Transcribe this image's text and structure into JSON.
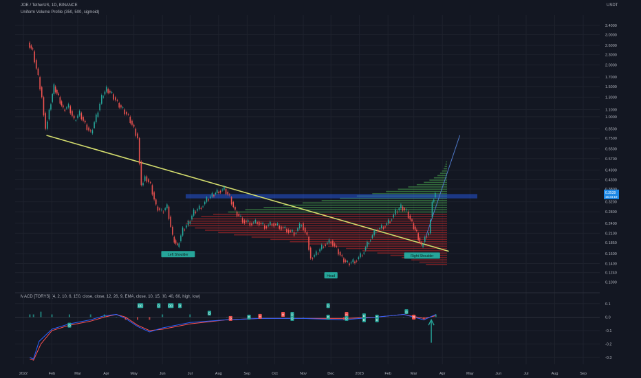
{
  "header": {
    "symbol_line": "JOE / TetherUS, 1D, BINANCE",
    "indicator_line": "Uniform Volume Profile (350, 500, sigmoid)",
    "macd_line": "MACD [TORYS] (4, 2, 10, 6, 150, close, close, 12, 26, 9, EMA, close, 10, 15, 30, 40, 60, high, low)",
    "currency": "USDT"
  },
  "chart_data": [
    {
      "type": "line",
      "subtype": "candlestick_with_volume_profile",
      "title": "JOE / TetherUS, 1D, BINANCE",
      "ylabel": "USDT",
      "yscale": "log",
      "ylim": [
        0.1,
        3.9
      ],
      "y_ticks": [
        "3.4000",
        "3.0000",
        "2.6000",
        "2.3000",
        "2.0000",
        "1.7000",
        "1.5000",
        "1.3000",
        "1.1000",
        "1.0000",
        "0.8500",
        "0.7500",
        "0.6500",
        "0.5700",
        "0.4900",
        "0.4300",
        "0.3800",
        "0.3200",
        "0.2800",
        "0.2400",
        "0.2100",
        "0.1850",
        "0.1600",
        "0.1400",
        "0.1240",
        "0.1090"
      ],
      "y_tick_values": [
        3.4,
        3.0,
        2.6,
        2.3,
        2.0,
        1.7,
        1.5,
        1.3,
        1.1,
        1.0,
        0.85,
        0.75,
        0.65,
        0.57,
        0.49,
        0.43,
        0.38,
        0.32,
        0.28,
        0.24,
        0.21,
        0.185,
        0.16,
        0.14,
        0.124,
        0.109
      ],
      "x_ticks": [
        "2022",
        "Feb",
        "Mar",
        "Apr",
        "May",
        "Jun",
        "Jul",
        "Aug",
        "Sep",
        "Oct",
        "Nov",
        "Dec",
        "2023",
        "Feb",
        "Mar",
        "Apr",
        "May",
        "Jun",
        "Jul",
        "Aug",
        "Sep"
      ],
      "x_tick_months": [
        0,
        1,
        2,
        3,
        4,
        5,
        6,
        7,
        8,
        9,
        10,
        11,
        12,
        13,
        14,
        15,
        16,
        17,
        18,
        19,
        20
      ],
      "x_start": "2022-01-01",
      "price_series": [
        [
          "2022-01-07",
          2.7
        ],
        [
          "2022-01-12",
          2.4
        ],
        [
          "2022-01-18",
          1.7
        ],
        [
          "2022-01-22",
          1.3
        ],
        [
          "2022-01-26",
          0.85
        ],
        [
          "2022-01-30",
          1.1
        ],
        [
          "2022-02-04",
          1.5
        ],
        [
          "2022-02-09",
          1.3
        ],
        [
          "2022-02-14",
          1.1
        ],
        [
          "2022-02-20",
          1.15
        ],
        [
          "2022-02-26",
          0.95
        ],
        [
          "2022-03-04",
          1.05
        ],
        [
          "2022-03-10",
          0.9
        ],
        [
          "2022-03-16",
          0.8
        ],
        [
          "2022-03-22",
          1.0
        ],
        [
          "2022-03-28",
          1.3
        ],
        [
          "2022-04-02",
          1.45
        ],
        [
          "2022-04-08",
          1.35
        ],
        [
          "2022-04-14",
          1.2
        ],
        [
          "2022-04-20",
          1.1
        ],
        [
          "2022-04-26",
          1.0
        ],
        [
          "2022-05-02",
          0.85
        ],
        [
          "2022-05-06",
          0.75
        ],
        [
          "2022-05-10",
          0.4
        ],
        [
          "2022-05-14",
          0.45
        ],
        [
          "2022-05-20",
          0.4
        ],
        [
          "2022-05-26",
          0.3
        ],
        [
          "2022-06-01",
          0.28
        ],
        [
          "2022-06-07",
          0.3
        ],
        [
          "2022-06-13",
          0.2
        ],
        [
          "2022-06-18",
          0.175
        ],
        [
          "2022-06-24",
          0.22
        ],
        [
          "2022-06-30",
          0.24
        ],
        [
          "2022-07-06",
          0.28
        ],
        [
          "2022-07-14",
          0.3
        ],
        [
          "2022-07-20",
          0.33
        ],
        [
          "2022-07-26",
          0.35
        ],
        [
          "2022-08-02",
          0.37
        ],
        [
          "2022-08-08",
          0.38
        ],
        [
          "2022-08-14",
          0.34
        ],
        [
          "2022-08-20",
          0.28
        ],
        [
          "2022-08-28",
          0.25
        ],
        [
          "2022-09-05",
          0.24
        ],
        [
          "2022-09-13",
          0.245
        ],
        [
          "2022-09-21",
          0.23
        ],
        [
          "2022-09-29",
          0.24
        ],
        [
          "2022-10-07",
          0.23
        ],
        [
          "2022-10-15",
          0.22
        ],
        [
          "2022-10-23",
          0.21
        ],
        [
          "2022-10-31",
          0.24
        ],
        [
          "2022-11-06",
          0.2
        ],
        [
          "2022-11-10",
          0.15
        ],
        [
          "2022-11-16",
          0.16
        ],
        [
          "2022-11-24",
          0.18
        ],
        [
          "2022-12-02",
          0.19
        ],
        [
          "2022-12-08",
          0.17
        ],
        [
          "2022-12-14",
          0.15
        ],
        [
          "2022-12-20",
          0.14
        ],
        [
          "2022-12-28",
          0.145
        ],
        [
          "2023-01-05",
          0.16
        ],
        [
          "2023-01-12",
          0.19
        ],
        [
          "2023-01-20",
          0.22
        ],
        [
          "2023-01-28",
          0.23
        ],
        [
          "2023-02-04",
          0.25
        ],
        [
          "2023-02-10",
          0.28
        ],
        [
          "2023-02-16",
          0.3
        ],
        [
          "2023-02-22",
          0.28
        ],
        [
          "2023-02-28",
          0.24
        ],
        [
          "2023-03-05",
          0.21
        ],
        [
          "2023-03-10",
          0.175
        ],
        [
          "2023-03-14",
          0.2
        ],
        [
          "2023-03-18",
          0.21
        ],
        [
          "2023-03-22",
          0.32
        ],
        [
          "2023-03-25",
          0.36
        ]
      ],
      "last_price_label": "0.3539",
      "countdown_label": "15:34:19",
      "annotations": [
        {
          "label": "Left Shoulder",
          "date": "2022-06-18",
          "y": 0.158
        },
        {
          "label": "Head",
          "date": "2022-12-01",
          "y": 0.119
        },
        {
          "label": "Right Shoulder",
          "date": "2023-03-10",
          "y": 0.155
        }
      ],
      "trendlines": [
        {
          "name": "neckline",
          "from": [
            "2022-01-26",
            0.78
          ],
          "to": [
            "2023-04-08",
            0.165
          ]
        },
        {
          "name": "projection",
          "from": [
            "2023-03-14",
            0.2
          ],
          "to": [
            "2023-04-20",
            0.78
          ]
        }
      ]
    },
    {
      "type": "line",
      "title": "MACD [TORYS]",
      "ylim": [
        -0.35,
        0.15
      ],
      "y_ticks": [
        "0.1",
        "0.0",
        "-0.1",
        "-0.2",
        "-0.3"
      ],
      "y_tick_values": [
        0.1,
        0.0,
        -0.1,
        -0.2,
        -0.3
      ],
      "series": [
        {
          "color": "#ff5252",
          "values": [
            [
              "2022-01-08",
              -0.31
            ],
            [
              "2022-01-12",
              -0.32
            ],
            [
              "2022-01-20",
              -0.2
            ],
            [
              "2022-02-01",
              -0.1
            ],
            [
              "2022-02-20",
              -0.06
            ],
            [
              "2022-03-15",
              -0.03
            ],
            [
              "2022-03-30",
              0.0
            ],
            [
              "2022-04-12",
              0.02
            ],
            [
              "2022-04-22",
              0.0
            ],
            [
              "2022-05-05",
              -0.06
            ],
            [
              "2022-05-18",
              -0.1
            ],
            [
              "2022-06-01",
              -0.09
            ],
            [
              "2022-07-01",
              -0.05
            ],
            [
              "2022-08-10",
              -0.02
            ],
            [
              "2022-09-15",
              -0.01
            ],
            [
              "2022-11-01",
              -0.01
            ],
            [
              "2022-12-15",
              -0.01
            ],
            [
              "2023-01-20",
              0.0
            ],
            [
              "2023-02-18",
              0.02
            ],
            [
              "2023-03-12",
              -0.01
            ],
            [
              "2023-03-25",
              0.01
            ]
          ]
        },
        {
          "color": "#2962ff",
          "values": [
            [
              "2022-01-08",
              -0.3
            ],
            [
              "2022-01-12",
              -0.31
            ],
            [
              "2022-01-18",
              -0.18
            ],
            [
              "2022-02-01",
              -0.09
            ],
            [
              "2022-02-20",
              -0.05
            ],
            [
              "2022-03-15",
              -0.02
            ],
            [
              "2022-03-30",
              0.01
            ],
            [
              "2022-04-12",
              0.02
            ],
            [
              "2022-04-22",
              -0.01
            ],
            [
              "2022-05-05",
              -0.07
            ],
            [
              "2022-05-18",
              -0.11
            ],
            [
              "2022-06-01",
              -0.08
            ],
            [
              "2022-07-01",
              -0.04
            ],
            [
              "2022-08-10",
              -0.02
            ],
            [
              "2022-09-15",
              -0.01
            ],
            [
              "2022-11-01",
              -0.01
            ],
            [
              "2022-12-15",
              -0.02
            ],
            [
              "2023-01-20",
              0.0
            ],
            [
              "2023-02-18",
              0.02
            ],
            [
              "2023-03-12",
              -0.02
            ],
            [
              "2023-03-25",
              0.02
            ]
          ]
        }
      ],
      "markers": [
        {
          "label": "DD",
          "date": "2022-05-08",
          "y": 0.085,
          "color": "#26a69a"
        },
        {
          "label": "D",
          "date": "2022-05-28",
          "y": 0.085,
          "color": "#26a69a"
        },
        {
          "label": "DD",
          "date": "2022-06-10",
          "y": 0.085,
          "color": "#26a69a"
        },
        {
          "label": "D",
          "date": "2022-06-20",
          "y": 0.085,
          "color": "#26a69a"
        },
        {
          "label": "D",
          "date": "2022-02-20",
          "y": -0.06,
          "color": "#26a69a"
        },
        {
          "label": "D",
          "date": "2022-07-22",
          "y": 0.03,
          "color": "#26a69a"
        },
        {
          "label": "D",
          "date": "2022-08-14",
          "y": -0.01,
          "color": "#ef5350"
        },
        {
          "label": "D",
          "date": "2022-09-03",
          "y": 0.0,
          "color": "#26a69a"
        },
        {
          "label": "H",
          "date": "2022-09-15",
          "y": 0.005,
          "color": "#ef5350"
        },
        {
          "label": "H",
          "date": "2022-10-10",
          "y": 0.02,
          "color": "#ef5350"
        },
        {
          "label": "D",
          "date": "2022-10-20",
          "y": 0.02,
          "color": "#26a69a"
        },
        {
          "label": "D",
          "date": "2022-10-20",
          "y": -0.01,
          "color": "#26a69a"
        },
        {
          "label": "D",
          "date": "2022-11-28",
          "y": 0.085,
          "color": "#26a69a"
        },
        {
          "label": "D",
          "date": "2022-11-28",
          "y": 0.0,
          "color": "#26a69a"
        },
        {
          "label": "H",
          "date": "2022-12-18",
          "y": 0.02,
          "color": "#ef5350"
        },
        {
          "label": "D",
          "date": "2022-12-18",
          "y": -0.01,
          "color": "#26a69a"
        },
        {
          "label": "D",
          "date": "2023-01-06",
          "y": 0.01,
          "color": "#26a69a"
        },
        {
          "label": "D",
          "date": "2023-01-06",
          "y": -0.02,
          "color": "#26a69a"
        },
        {
          "label": "D",
          "date": "2023-01-20",
          "y": 0.0,
          "color": "#26a69a"
        },
        {
          "label": "D",
          "date": "2023-01-20",
          "y": -0.02,
          "color": "#26a69a"
        },
        {
          "label": "D",
          "date": "2023-02-21",
          "y": 0.04,
          "color": "#26a69a"
        },
        {
          "label": "D",
          "date": "2023-03-01",
          "y": 0.0,
          "color": "#ef5350"
        }
      ]
    }
  ],
  "colors": {
    "background": "#131722",
    "grid": "#1e222d",
    "axis_text": "#b2b5be",
    "up": "#26a69a",
    "down": "#ef5350",
    "neckline": "#d4dd6e",
    "projection": "#4f79c9",
    "volume_up": "#4caf50",
    "volume_down": "#c62828",
    "value_area": "#2962ff",
    "arrow": "#26a69a"
  }
}
